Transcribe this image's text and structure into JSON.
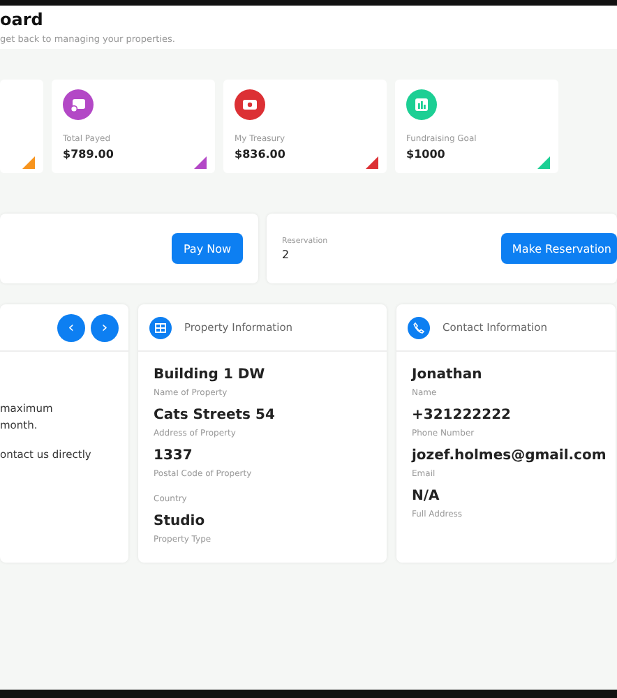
{
  "header": {
    "title": "oard",
    "subtitle": "get back to managing your properties."
  },
  "stats": [
    {
      "color": "#f7941d"
    },
    {
      "label": "Total Payed",
      "value": "$789.00",
      "color": "#b348c6"
    },
    {
      "label": "My Treasury",
      "value": "$836.00",
      "color": "#dc3034"
    },
    {
      "label": "Fundraising Goal",
      "value": "$1000",
      "color": "#1ccf94"
    }
  ],
  "payment": {
    "button": "Pay Now"
  },
  "reservation": {
    "label": "Reservation",
    "value": "2",
    "button": "Make Reservation"
  },
  "notice": {
    "prev": "‹",
    "next": "›",
    "lines": [
      "maximum",
      "month.",
      "ontact us directly"
    ]
  },
  "property": {
    "title": "Property Information",
    "fields": [
      {
        "value": "Building 1 DW",
        "label": "Name of Property"
      },
      {
        "value": "Cats Streets 54",
        "label": "Address of Property"
      },
      {
        "value": "1337",
        "label": "Postal Code of Property"
      },
      {
        "label": "Country"
      },
      {
        "value": "Studio",
        "label": "Property Type"
      }
    ]
  },
  "contact": {
    "title": "Contact Information",
    "fields": [
      {
        "value": "Jonathan",
        "label": "Name"
      },
      {
        "value": "+321222222",
        "label": "Phone Number"
      },
      {
        "value": "jozef.holmes@gmail.com",
        "label": "Email"
      },
      {
        "value": "N/A",
        "label": "Full Address"
      }
    ]
  }
}
